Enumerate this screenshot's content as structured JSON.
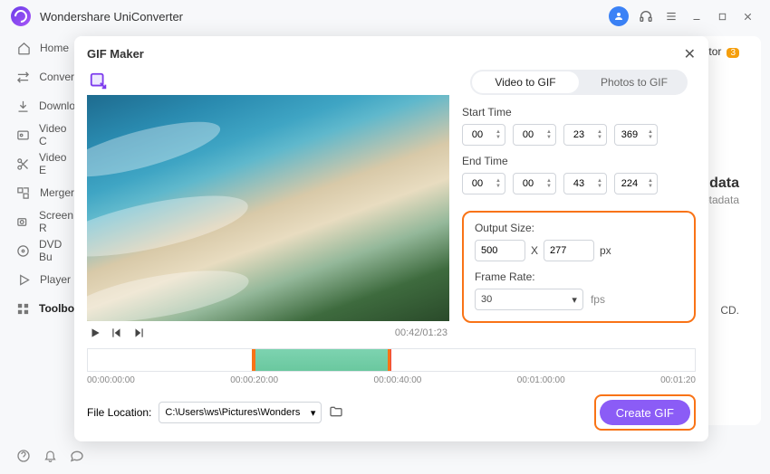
{
  "app": {
    "brand": "Wondershare UniConverter"
  },
  "sidebar": {
    "items": [
      {
        "label": "Home"
      },
      {
        "label": "Conver"
      },
      {
        "label": "Downlo"
      },
      {
        "label": "Video C"
      },
      {
        "label": "Video E"
      },
      {
        "label": "Merger"
      },
      {
        "label": "Screen R"
      },
      {
        "label": "DVD Bu"
      },
      {
        "label": "Player"
      },
      {
        "label": "Toolbo"
      }
    ]
  },
  "backdrop": {
    "tor_label": "tor",
    "badge": "3",
    "data_label": "data",
    "tadata": "etadata",
    "cd": "CD."
  },
  "modal": {
    "title": "GIF Maker",
    "tabs": {
      "video": "Video to GIF",
      "photos": "Photos to GIF"
    },
    "start_label": "Start Time",
    "end_label": "End Time",
    "start": [
      "00",
      "00",
      "23",
      "369"
    ],
    "end": [
      "00",
      "00",
      "43",
      "224"
    ],
    "output_label": "Output Size:",
    "width": "500",
    "x": "X",
    "height": "277",
    "px": "px",
    "rate_label": "Frame Rate:",
    "rate": "30",
    "fps": "fps",
    "time": "00:42/01:23",
    "timeline": [
      "00:00:00:00",
      "00:00:20:00",
      "00:00:40:00",
      "00:01:00:00",
      "00:01:20"
    ],
    "fileloc_label": "File Location:",
    "fileloc": "C:\\Users\\ws\\Pictures\\Wonders",
    "create": "Create GIF"
  }
}
